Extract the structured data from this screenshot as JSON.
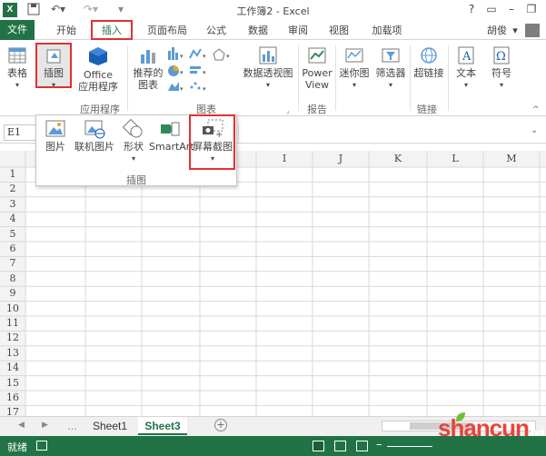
{
  "window": {
    "title": "工作簿2 - Excel",
    "logo": "X"
  },
  "tabs": {
    "file": "文件",
    "home": "开始",
    "insert": "插入",
    "layout": "页面布局",
    "formulas": "公式",
    "data": "数据",
    "review": "审阅",
    "view": "视图",
    "addins": "加载项",
    "user": "胡俊"
  },
  "ribbon": {
    "table": "表格",
    "illustrations": "插图",
    "office_apps_1": "Office",
    "office_apps_2": "应用程序",
    "group_apps": "应用程序",
    "recommended_1": "推荐的",
    "recommended_2": "图表",
    "pivotchart": "数据透视图",
    "powerview_1": "Power",
    "powerview_2": "View",
    "group_charts": "图表",
    "group_reports": "报告",
    "sparklines": "迷你图",
    "filter": "筛选器",
    "hyperlink": "超链接",
    "group_links": "链接",
    "text": "文本",
    "symbol": "符号"
  },
  "panel": {
    "picture": "图片",
    "online_picture": "联机图片",
    "shapes": "形状",
    "smartart": "SmartArt",
    "screenshot": "屏幕截图",
    "group": "插图"
  },
  "namebox": "E1",
  "columns": [
    "I",
    "J",
    "K",
    "L",
    "M"
  ],
  "rows": [
    "1",
    "2",
    "3",
    "4",
    "5",
    "6",
    "7",
    "8",
    "9",
    "10",
    "11",
    "12",
    "13",
    "14",
    "15",
    "16",
    "17"
  ],
  "sheets": [
    "Sheet1",
    "Sheet3"
  ],
  "status": {
    "ready": "就绪"
  },
  "watermark": {
    "brand": "shancun",
    "tld": ".net"
  },
  "colors": {
    "accent": "#217346",
    "highlight": "#e23030"
  }
}
